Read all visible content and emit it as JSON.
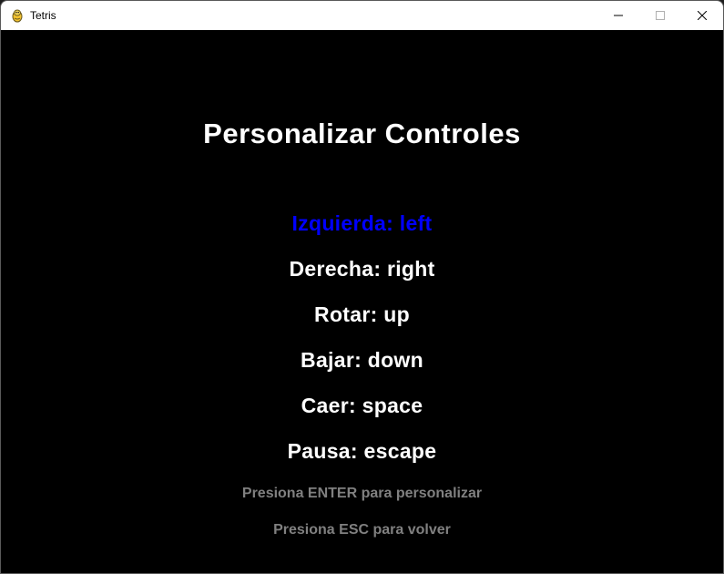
{
  "window": {
    "title": "Tetris",
    "icon": "pygame-snake-icon"
  },
  "colors": {
    "background": "#000000",
    "text": "#ffffff",
    "selected": "#0000ff",
    "hint": "#808080"
  },
  "screen": {
    "title": "Personalizar Controles",
    "selected_index": 0,
    "controls": [
      {
        "label": "Izquierda: left"
      },
      {
        "label": "Derecha: right"
      },
      {
        "label": "Rotar: up"
      },
      {
        "label": "Bajar: down"
      },
      {
        "label": "Caer: space"
      },
      {
        "label": "Pausa: escape"
      }
    ],
    "hints": [
      "Presiona ENTER para personalizar",
      "Presiona ESC para volver"
    ]
  }
}
